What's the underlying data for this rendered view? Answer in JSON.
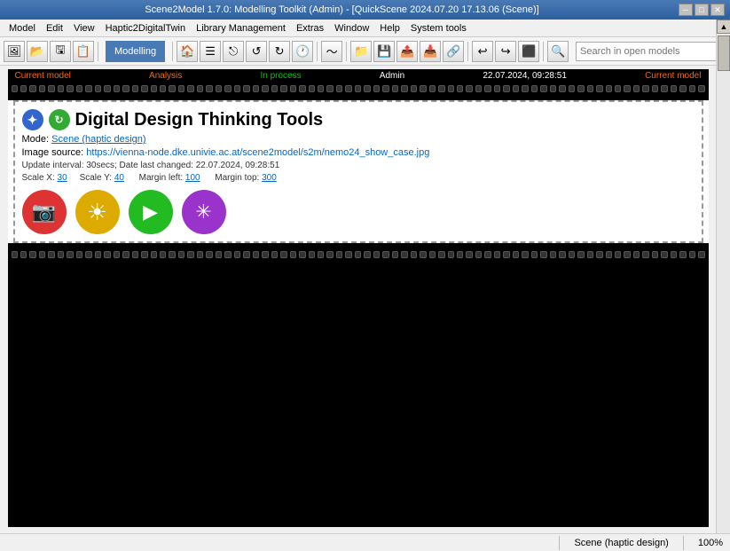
{
  "titlebar": {
    "text": "Scene2Model 1.7.0: Modelling Toolkit (Admin) - [QuickScene 2024.07.20 17.13.06 (Scene)]",
    "min": "─",
    "max": "□",
    "close": "✕"
  },
  "menubar": {
    "items": [
      "Model",
      "Edit",
      "View",
      "Haptic2DigitalTwin",
      "Library Management",
      "Extras",
      "Window",
      "Help",
      "System tools"
    ]
  },
  "toolbar": {
    "label": "Modelling",
    "search_placeholder": "Search in open models"
  },
  "filmstrip": {
    "labels": [
      "Current model",
      "Analysis",
      "In process",
      "Admin",
      "22.07.2024, 09:28:51",
      "Current model"
    ]
  },
  "scene": {
    "title": "Digital Design Thinking Tools",
    "mode_label": "Mode:",
    "mode_link": "Scene (haptic design)",
    "image_label": "Image source:",
    "image_url": "https://vienna-node.dke.univie.ac.at/scene2model/s2m/nemo24_show_case.jpg",
    "update_info": "Update interval: 30secs; Date last changed: 22.07.2024, 09:28:51",
    "scale_x_label": "Scale X:",
    "scale_x": "30",
    "scale_y_label": "Scale Y:",
    "scale_y": "40",
    "margin_left_label": "Margin left:",
    "margin_left": "100",
    "margin_top_label": "Margin top:",
    "margin_top": "300"
  },
  "action_buttons": [
    {
      "id": "camera",
      "icon": "📷",
      "color": "#dd3333",
      "label": "camera-button"
    },
    {
      "id": "sun",
      "icon": "☀",
      "color": "#ddaa00",
      "label": "sun-button"
    },
    {
      "id": "play",
      "icon": "▶",
      "color": "#22bb22",
      "label": "play-button"
    },
    {
      "id": "settings",
      "icon": "✳",
      "color": "#9933cc",
      "label": "settings-button"
    }
  ],
  "statusbar": {
    "scene": "Scene (haptic design)",
    "zoom": "100%"
  }
}
